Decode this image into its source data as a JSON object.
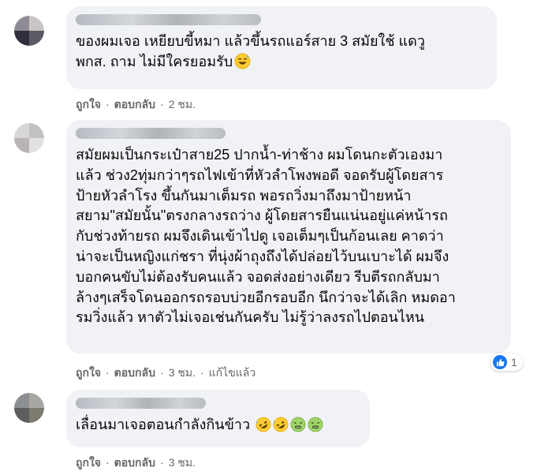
{
  "comments": [
    {
      "text": "ของผมเจอ เหยียบขี้หมา แล้วขึ้นรถแอร์สาย 3 สมัยใช้ แดวู\nพกส. ถาม ไม่มีใครยอมรับ",
      "emojis": [
        "smile-sweat"
      ],
      "like_label": "ถูกใจ",
      "reply_label": "ตอบกลับ",
      "time": "2 ชม."
    },
    {
      "text": "สมัยผมเป็นกระเป๋าสาย25 ปากน้ำ-ท่าช้าง ผมโดนกะตัวเองมา\nแล้ว ช่วง2ทุ่มกว่าๆรถไฟเข้าที่หัวลำโพงพอดี จอดรับผู้โดยสาร\nป้ายหัวลำโรง ขึ้นกันมาเต็มรถ พอรถวิ่งมาถึงมาป้ายหน้า\nสยาม\"สมัยนั้น\"ตรงกลางรถว่าง ผู้โดยสารยืนแน่นอยู่แค่หน้ารถ\nกับช่วงท้ายรถ ผมจึงเดินเข้าไปดู เจอเต็มๆเป็นก้อนเลย คาดว่า\nน่าจะเป็นหญิงแก่ชรา ที่นุ่งผ้าถุงถึงได้ปล่อยไว้บนเบาะได้ ผมจึง\nบอกคนขับไม่ต้องรับคนแล้ว จอดส่งอย่างเดียว รีบตีรถกลับมา\nล้างๆเสร็จโดนออกรถรอบบ่วยอีกรอบอีก นึกว่าจะได้เลิก หมดอา\nรมวิ่งแล้ว หาตัวไม่เจอเช่นกันครับ ไม่รู้ว่าลงรถไปตอนไหน",
      "like_label": "ถูกใจ",
      "reply_label": "ตอบกลับ",
      "time": "3 ชม.",
      "edited_label": "แก้ไขแล้ว",
      "reaction_count": "1"
    },
    {
      "text": "เลื่อนมาเจอตอนกำลังกินข้าว",
      "emojis": [
        "rofl",
        "rofl",
        "nauseated",
        "nauseated"
      ],
      "like_label": "ถูกใจ",
      "reply_label": "ตอบกลับ",
      "time": "3 ชม."
    }
  ],
  "colors": {
    "bubble": "#f0f2f5",
    "meta_text": "#65676b",
    "like_blue": "#1877f2"
  }
}
